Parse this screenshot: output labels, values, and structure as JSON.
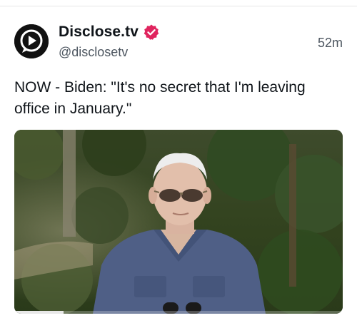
{
  "post": {
    "author_name": "Disclose.tv",
    "handle": "@disclosetv",
    "time_ago": "52m",
    "text": "NOW - Biden: \"It's no secret that I'm leaving office in January.\"",
    "avatar_icon": "play-logo-icon",
    "verified_icon": "verified-badge-icon",
    "accent_color": "#e0245e"
  },
  "media": {
    "type": "video",
    "progress_fraction": 0.15
  }
}
